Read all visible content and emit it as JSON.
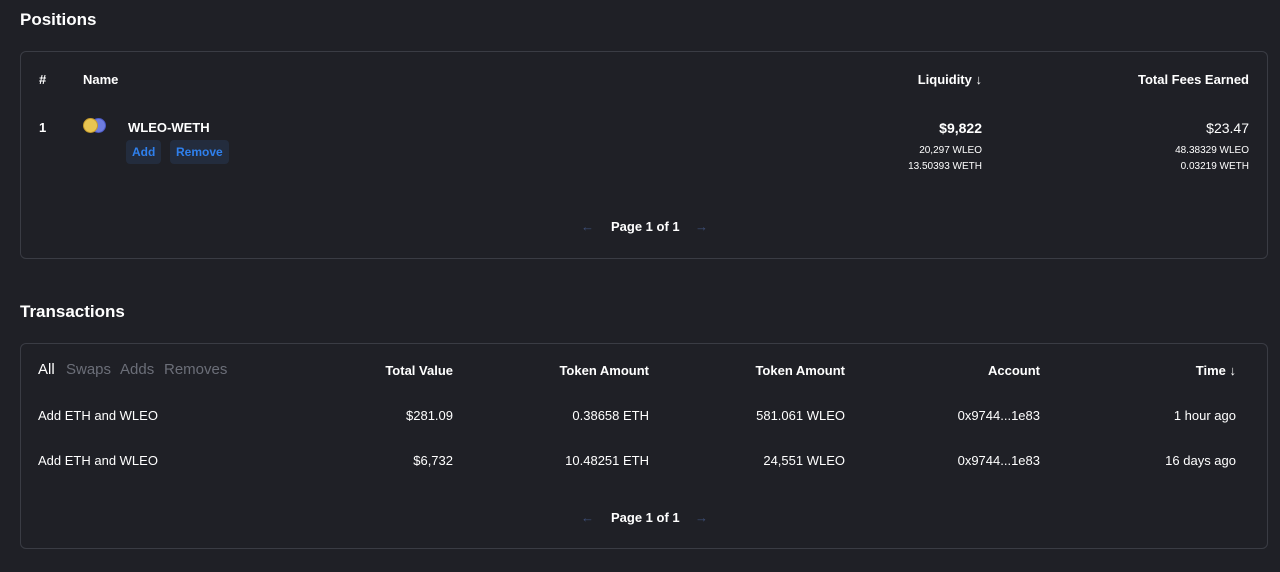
{
  "positions": {
    "title": "Positions",
    "headers": {
      "index": "#",
      "name": "Name",
      "liquidity": "Liquidity",
      "liquidity_sort": "↓",
      "fees": "Total Fees Earned"
    },
    "rows": [
      {
        "index": "1",
        "pair": "WLEO-WETH",
        "add_label": "Add",
        "remove_label": "Remove",
        "liquidity_usd": "$9,822",
        "liquidity_token0": "20,297 WLEO",
        "liquidity_token1": "13.50393 WETH",
        "fees_usd": "$23.47",
        "fees_token0": "48.38329 WLEO",
        "fees_token1": "0.03219 WETH"
      }
    ],
    "pager": {
      "prev": "←",
      "text": "Page 1 of 1",
      "next": "→"
    }
  },
  "transactions": {
    "title": "Transactions",
    "filters": [
      "All",
      "Swaps",
      "Adds",
      "Removes"
    ],
    "active_filter": "All",
    "headers": {
      "total_value": "Total Value",
      "token_amount_1": "Token Amount",
      "token_amount_2": "Token Amount",
      "account": "Account",
      "time": "Time",
      "time_sort": "↓"
    },
    "rows": [
      {
        "action": "Add ETH and WLEO",
        "total_value": "$281.09",
        "token_amount_1": "0.38658 ETH",
        "token_amount_2": "581.061 WLEO",
        "account": "0x9744...1e83",
        "time": "1 hour ago"
      },
      {
        "action": "Add ETH and WLEO",
        "total_value": "$6,732",
        "token_amount_1": "10.48251 ETH",
        "token_amount_2": "24,551 WLEO",
        "account": "0x9744...1e83",
        "time": "16 days ago"
      }
    ],
    "pager": {
      "prev": "←",
      "text": "Page 1 of 1",
      "next": "→"
    }
  },
  "colors": {
    "background": "#1f2026",
    "border": "#3a3c44",
    "link": "#2f80ed",
    "positive": "#27ae60",
    "muted": "#6b6e78"
  }
}
